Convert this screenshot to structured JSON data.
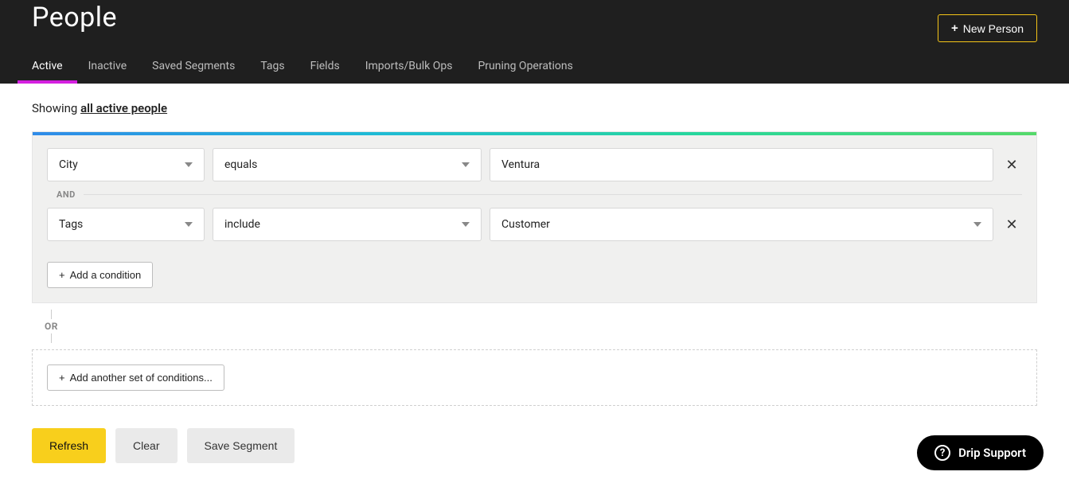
{
  "header": {
    "title": "People",
    "new_person_label": "New Person"
  },
  "tabs": [
    {
      "label": "Active",
      "active": true
    },
    {
      "label": "Inactive",
      "active": false
    },
    {
      "label": "Saved Segments",
      "active": false
    },
    {
      "label": "Tags",
      "active": false
    },
    {
      "label": "Fields",
      "active": false
    },
    {
      "label": "Imports/Bulk Ops",
      "active": false
    },
    {
      "label": "Pruning Operations",
      "active": false
    }
  ],
  "showing": {
    "prefix": "Showing ",
    "link": "all active people"
  },
  "conditions": {
    "rows": [
      {
        "field": "City",
        "operator": "equals",
        "value": "Ventura",
        "value_is_select": false
      },
      {
        "field": "Tags",
        "operator": "include",
        "value": "Customer",
        "value_is_select": true
      }
    ],
    "and_label": "AND",
    "add_condition_label": "Add a condition"
  },
  "or_section": {
    "or_label": "OR",
    "add_set_label": "Add another set of conditions..."
  },
  "actions": {
    "refresh": "Refresh",
    "clear": "Clear",
    "save_segment": "Save Segment"
  },
  "support": {
    "label": "Drip Support"
  }
}
